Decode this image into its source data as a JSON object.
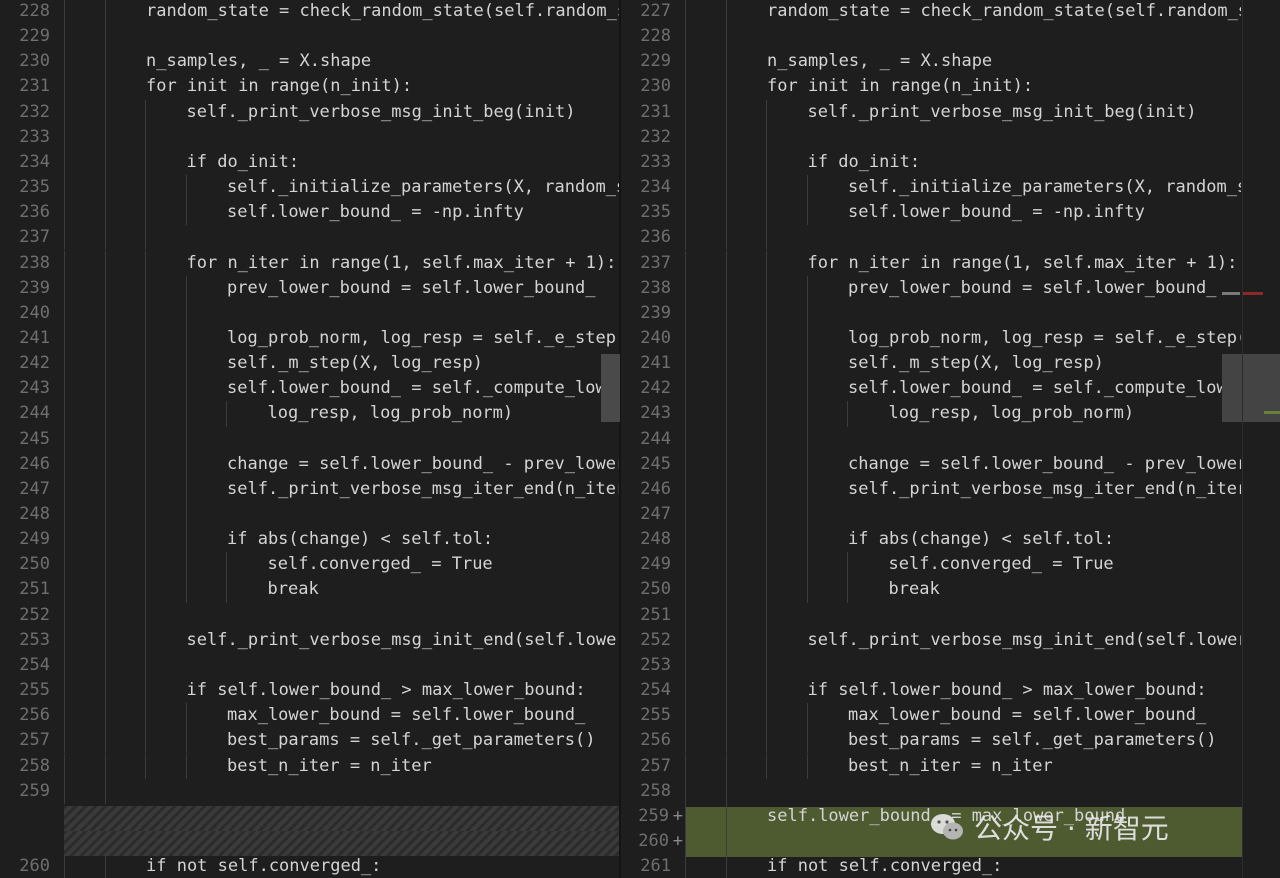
{
  "colors": {
    "background": "#1e1e1e",
    "text": "#d4d4d4",
    "line_number": "#6f6f6f",
    "added_line_bg": "#4e5b31",
    "removed_marker": "#8b2a2a",
    "added_marker": "#6b7f3a"
  },
  "left_pane": {
    "lines": [
      {
        "n": "228",
        "indent": 2,
        "text": "random_state = check_random_state(self.random_s"
      },
      {
        "n": "229",
        "indent": 0,
        "text": ""
      },
      {
        "n": "230",
        "indent": 2,
        "text": "n_samples, _ = X.shape"
      },
      {
        "n": "231",
        "indent": 2,
        "text": "for init in range(n_init):"
      },
      {
        "n": "232",
        "indent": 3,
        "text": "self._print_verbose_msg_init_beg(init)"
      },
      {
        "n": "233",
        "indent": 0,
        "text": ""
      },
      {
        "n": "234",
        "indent": 3,
        "text": "if do_init:"
      },
      {
        "n": "235",
        "indent": 4,
        "text": "self._initialize_parameters(X, random_s"
      },
      {
        "n": "236",
        "indent": 4,
        "text": "self.lower_bound_ = -np.infty"
      },
      {
        "n": "237",
        "indent": 0,
        "text": ""
      },
      {
        "n": "238",
        "indent": 3,
        "text": "for n_iter in range(1, self.max_iter + 1):"
      },
      {
        "n": "239",
        "indent": 4,
        "text": "prev_lower_bound = self.lower_bound_"
      },
      {
        "n": "240",
        "indent": 0,
        "text": ""
      },
      {
        "n": "241",
        "indent": 4,
        "text": "log_prob_norm, log_resp = self._e_step("
      },
      {
        "n": "242",
        "indent": 4,
        "text": "self._m_step(X, log_resp)"
      },
      {
        "n": "243",
        "indent": 4,
        "text": "self.lower_bound_ = self._compute_lower"
      },
      {
        "n": "244",
        "indent": 5,
        "text": "log_resp, log_prob_norm)"
      },
      {
        "n": "245",
        "indent": 0,
        "text": ""
      },
      {
        "n": "246",
        "indent": 4,
        "text": "change = self.lower_bound_ - prev_lower"
      },
      {
        "n": "247",
        "indent": 4,
        "text": "self._print_verbose_msg_iter_end(n_iter"
      },
      {
        "n": "248",
        "indent": 0,
        "text": ""
      },
      {
        "n": "249",
        "indent": 4,
        "text": "if abs(change) < self.tol:"
      },
      {
        "n": "250",
        "indent": 5,
        "text": "self.converged_ = True"
      },
      {
        "n": "251",
        "indent": 5,
        "text": "break"
      },
      {
        "n": "252",
        "indent": 0,
        "text": ""
      },
      {
        "n": "253",
        "indent": 3,
        "text": "self._print_verbose_msg_init_end(self.lower"
      },
      {
        "n": "254",
        "indent": 0,
        "text": ""
      },
      {
        "n": "255",
        "indent": 3,
        "text": "if self.lower_bound_ > max_lower_bound:"
      },
      {
        "n": "256",
        "indent": 4,
        "text": "max_lower_bound = self.lower_bound_"
      },
      {
        "n": "257",
        "indent": 4,
        "text": "best_params = self._get_parameters()"
      },
      {
        "n": "258",
        "indent": 4,
        "text": "best_n_iter = n_iter"
      },
      {
        "n": "259",
        "indent": 0,
        "text": ""
      },
      {
        "n": "",
        "indent": 0,
        "text": "",
        "hatch": true
      },
      {
        "n": "",
        "indent": 0,
        "text": "",
        "hatch": true
      },
      {
        "n": "260",
        "indent": 2,
        "text": "if not self.converged_:"
      }
    ]
  },
  "right_pane": {
    "lines": [
      {
        "n": "227",
        "indent": 2,
        "text": "random_state = check_random_state(self.random_s"
      },
      {
        "n": "228",
        "indent": 0,
        "text": ""
      },
      {
        "n": "229",
        "indent": 2,
        "text": "n_samples, _ = X.shape"
      },
      {
        "n": "230",
        "indent": 2,
        "text": "for init in range(n_init):"
      },
      {
        "n": "231",
        "indent": 3,
        "text": "self._print_verbose_msg_init_beg(init)"
      },
      {
        "n": "232",
        "indent": 0,
        "text": ""
      },
      {
        "n": "233",
        "indent": 3,
        "text": "if do_init:"
      },
      {
        "n": "234",
        "indent": 4,
        "text": "self._initialize_parameters(X, random_s"
      },
      {
        "n": "235",
        "indent": 4,
        "text": "self.lower_bound_ = -np.infty"
      },
      {
        "n": "236",
        "indent": 0,
        "text": ""
      },
      {
        "n": "237",
        "indent": 3,
        "text": "for n_iter in range(1, self.max_iter + 1):"
      },
      {
        "n": "238",
        "indent": 4,
        "text": "prev_lower_bound = self.lower_bound_"
      },
      {
        "n": "239",
        "indent": 0,
        "text": ""
      },
      {
        "n": "240",
        "indent": 4,
        "text": "log_prob_norm, log_resp = self._e_step("
      },
      {
        "n": "241",
        "indent": 4,
        "text": "self._m_step(X, log_resp)"
      },
      {
        "n": "242",
        "indent": 4,
        "text": "self.lower_bound_ = self._compute_lower"
      },
      {
        "n": "243",
        "indent": 5,
        "text": "log_resp, log_prob_norm)"
      },
      {
        "n": "244",
        "indent": 0,
        "text": ""
      },
      {
        "n": "245",
        "indent": 4,
        "text": "change = self.lower_bound_ - prev_lower"
      },
      {
        "n": "246",
        "indent": 4,
        "text": "self._print_verbose_msg_iter_end(n_iter"
      },
      {
        "n": "247",
        "indent": 0,
        "text": ""
      },
      {
        "n": "248",
        "indent": 4,
        "text": "if abs(change) < self.tol:"
      },
      {
        "n": "249",
        "indent": 5,
        "text": "self.converged_ = True"
      },
      {
        "n": "250",
        "indent": 5,
        "text": "break"
      },
      {
        "n": "251",
        "indent": 0,
        "text": ""
      },
      {
        "n": "252",
        "indent": 3,
        "text": "self._print_verbose_msg_init_end(self.lower"
      },
      {
        "n": "253",
        "indent": 0,
        "text": ""
      },
      {
        "n": "254",
        "indent": 3,
        "text": "if self.lower_bound_ > max_lower_bound:"
      },
      {
        "n": "255",
        "indent": 4,
        "text": "max_lower_bound = self.lower_bound_"
      },
      {
        "n": "256",
        "indent": 4,
        "text": "best_params = self._get_parameters()"
      },
      {
        "n": "257",
        "indent": 4,
        "text": "best_n_iter = n_iter"
      },
      {
        "n": "258",
        "indent": 0,
        "text": ""
      },
      {
        "n": "259",
        "indent": 2,
        "text": "self.lower_bound_ = max_lower_bound",
        "added": true,
        "marker": "+"
      },
      {
        "n": "260",
        "indent": 0,
        "text": "",
        "added": true,
        "marker": "+"
      },
      {
        "n": "261",
        "indent": 2,
        "text": "if not self.converged_:"
      }
    ]
  },
  "watermark": {
    "text": "公众号 · 新智元",
    "logo_icon": "wechat-icon"
  }
}
